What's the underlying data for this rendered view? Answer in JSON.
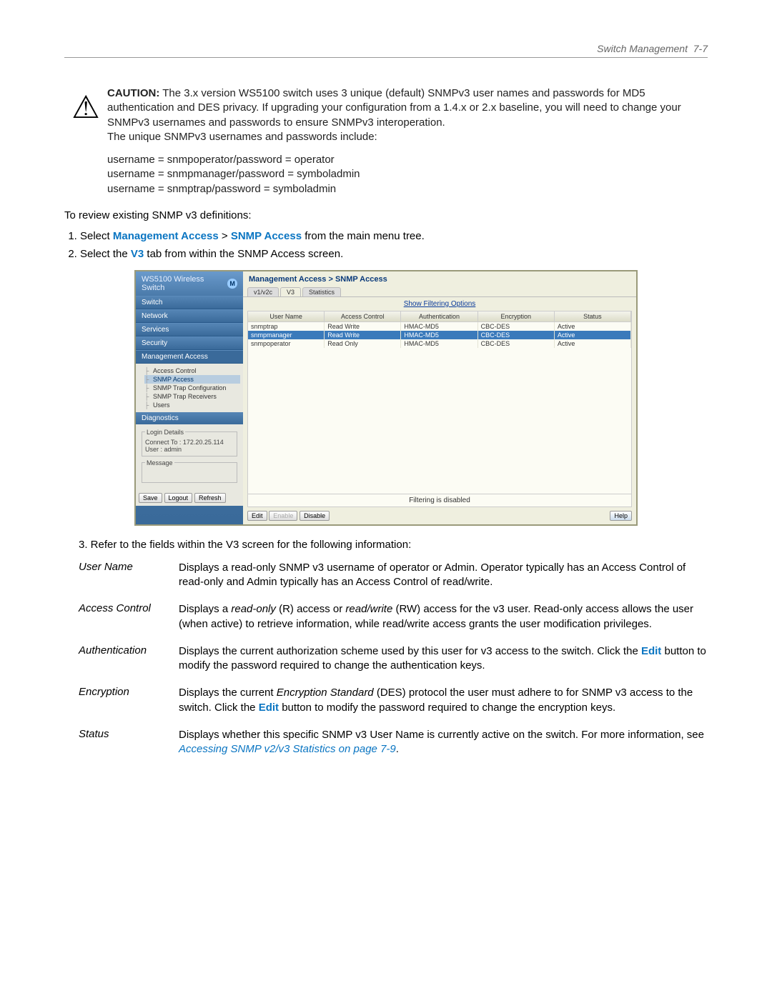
{
  "header": {
    "section": "Switch Management",
    "page": "7-7"
  },
  "caution": {
    "title": "CAUTION:",
    "body": "The 3.x version WS5100 switch uses 3 unique (default) SNMPv3 user names and passwords for MD5 authentication and DES privacy. If upgrading your configuration from a 1.4.x or 2.x baseline, you will need to change your SNMPv3 usernames and passwords to ensure SNMPv3 interoperation.",
    "body2": "The unique SNMPv3 usernames and passwords include:",
    "creds": [
      "username = snmpoperator/password = operator",
      "username = snmpmanager/password = symboladmin",
      "username = snmptrap/password = symboladmin"
    ]
  },
  "review_line": "To review existing SNMP v3 definitions:",
  "steps": {
    "s1a": "Select ",
    "s1b": "Management Access",
    "s1c": " > ",
    "s1d": "SNMP Access",
    "s1e": " from the main menu tree.",
    "s2a": "Select the ",
    "s2b": "V3",
    "s2c": " tab from within the SNMP Access screen."
  },
  "screenshot": {
    "app_title": "WS5100 Wireless Switch",
    "breadcrumb": "Management Access > SNMP Access",
    "tabs": [
      "v1/v2c",
      "V3",
      "Statistics"
    ],
    "filter_link": "Show Filtering Options",
    "nav_items": [
      "Switch",
      "Network",
      "Services",
      "Security",
      "Management Access"
    ],
    "subtree": [
      "Access Control",
      "SNMP Access",
      "SNMP Trap Configuration",
      "SNMP Trap Receivers",
      "Users"
    ],
    "diag": "Diagnostics",
    "login": {
      "legend": "Login Details",
      "connect_label": "Connect To :",
      "connect": "172.20.25.114",
      "user_label": "User :",
      "user": "admin",
      "msg_legend": "Message"
    },
    "nav_buttons": [
      "Save",
      "Logout",
      "Refresh"
    ],
    "table": {
      "headers": [
        "User Name",
        "Access Control",
        "Authentication",
        "Encryption",
        "Status"
      ],
      "rows": [
        [
          "snmptrap",
          "Read Write",
          "HMAC-MD5",
          "CBC-DES",
          "Active"
        ],
        [
          "snmpmanager",
          "Read Write",
          "HMAC-MD5",
          "CBC-DES",
          "Active"
        ],
        [
          "snmpoperator",
          "Read Only",
          "HMAC-MD5",
          "CBC-DES",
          "Active"
        ]
      ]
    },
    "status_bar": "Filtering is disabled",
    "bottom_buttons": {
      "edit": "Edit",
      "enable": "Enable",
      "disable": "Disable",
      "help": "Help"
    }
  },
  "step3": "3. Refer to the fields within the V3 screen for the following information:",
  "defs": {
    "username": {
      "term": "User Name",
      "desc": "Displays a read-only SNMP v3 username of operator or Admin. Operator typically has an Access Control of read-only and Admin typically has an Access Control of read/write."
    },
    "access": {
      "term": "Access Control",
      "d1": "Displays a ",
      "ro": "read-only",
      "d2": " (R) access or ",
      "rw": "read/write",
      "d3": " (RW) access for the v3 user. Read-only access allows the user (when active) to retrieve information, while read/write access grants the user modification privileges."
    },
    "auth": {
      "term": "Authentication",
      "d1": "Displays the current authorization scheme used by this user for v3 access to the switch. Click the ",
      "edit": "Edit",
      "d2": " button to modify the password required to change the authentication keys."
    },
    "enc": {
      "term": "Encryption",
      "d1": "Displays the current ",
      "es": "Encryption Standard",
      "d2": " (DES) protocol the user must adhere to for SNMP v3 access to the switch. Click the ",
      "edit": "Edit",
      "d3": " button to modify the password required to change the encryption keys."
    },
    "status": {
      "term": "Status",
      "d1": "Displays whether this specific SNMP v3 User Name is currently active on the switch. For more information, see ",
      "link": "Accessing SNMP v2/v3 Statistics on page 7-9",
      "d2": "."
    }
  }
}
